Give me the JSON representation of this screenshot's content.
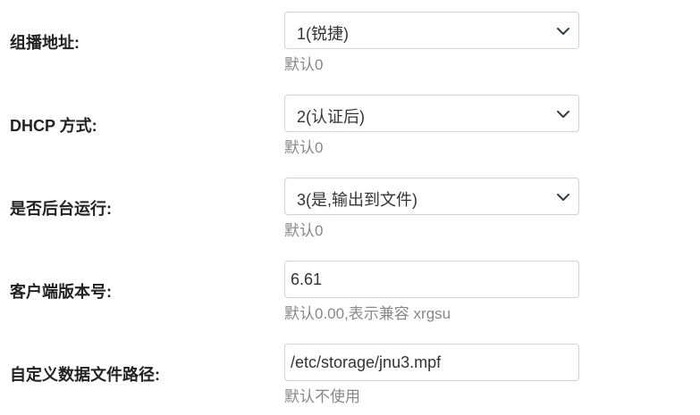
{
  "form": {
    "rows": [
      {
        "label": "组播地址:",
        "type": "select",
        "value": "1(锐捷)",
        "hint": "默认0"
      },
      {
        "label": "DHCP 方式:",
        "type": "select",
        "value": "2(认证后)",
        "hint": "默认0"
      },
      {
        "label": "是否后台运行:",
        "type": "select",
        "value": "3(是,输出到文件)",
        "hint": "默认0"
      },
      {
        "label": "客户端版本号:",
        "type": "input",
        "value": "6.61",
        "hint": "默认0.00,表示兼容 xrgsu"
      },
      {
        "label": "自定义数据文件路径:",
        "type": "input",
        "value": "/etc/storage/jnu3.mpf",
        "hint": "默认不使用"
      }
    ]
  },
  "icons": {
    "select_arrow": "chevron-down-icon"
  },
  "colors": {
    "border": "#cfd3d7",
    "hint_text": "#888888",
    "label_text": "#222222"
  }
}
